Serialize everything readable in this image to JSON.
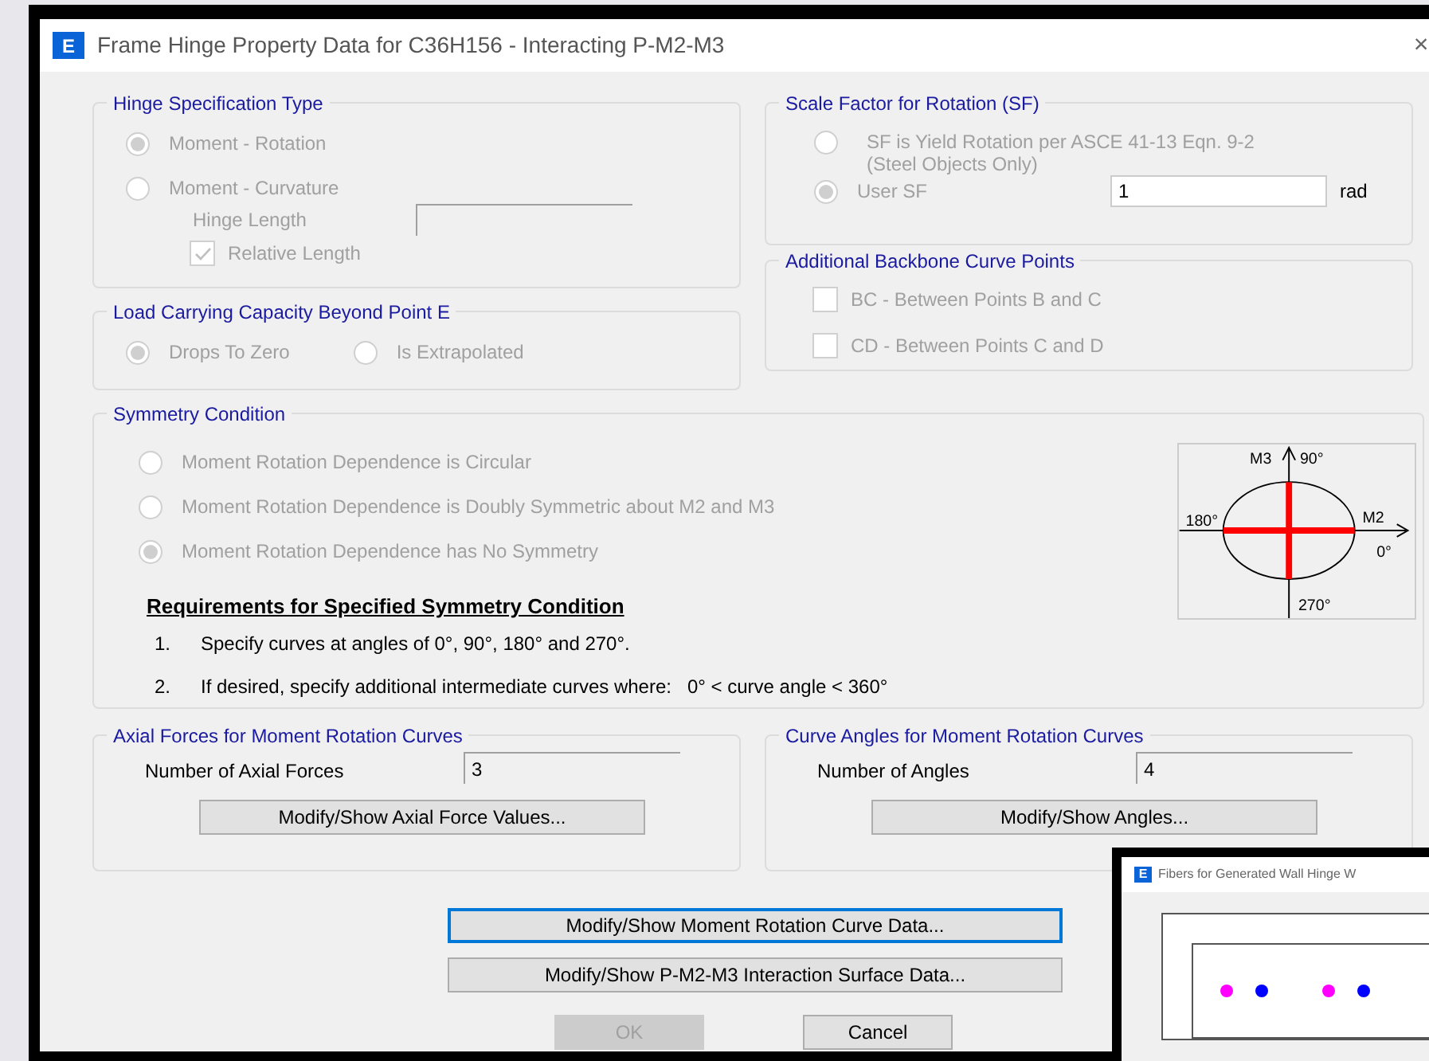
{
  "window": {
    "title": "Frame Hinge Property Data for C36H156 - Interacting P-M2-M3",
    "icon_letter": "E",
    "close": "×"
  },
  "hinge_specification": {
    "title": "Hinge Specification Type",
    "options": [
      {
        "label": "Moment - Rotation",
        "selected": true,
        "disabled": true
      },
      {
        "label": "Moment - Curvature",
        "selected": false,
        "disabled": true
      }
    ],
    "hinge_length": {
      "label": "Hinge Length",
      "disabled": true
    },
    "relative_length": {
      "label": "Relative Length",
      "checked": true,
      "disabled": true
    }
  },
  "load_capacity": {
    "title": "Load Carrying Capacity Beyond Point E",
    "options": [
      {
        "label": "Drops To Zero",
        "selected": true,
        "disabled": true
      },
      {
        "label": "Is Extrapolated",
        "selected": false,
        "disabled": true
      }
    ]
  },
  "scale_factor": {
    "title": "Scale Factor for Rotation (SF)",
    "options": [
      {
        "label": "SF is Yield Rotation per ASCE 41-13 Eqn. 9-2",
        "sublabel": "(Steel Objects Only)",
        "selected": false,
        "disabled": true
      },
      {
        "label": "User SF",
        "selected": true,
        "disabled": true
      }
    ],
    "value": "1",
    "unit": "rad"
  },
  "backbone_points": {
    "title": "Additional Backbone Curve Points",
    "options": [
      {
        "label": "BC - Between Points B and C",
        "checked": false,
        "disabled": true
      },
      {
        "label": "CD - Between Points C and D",
        "checked": false,
        "disabled": true
      }
    ]
  },
  "symmetry": {
    "title": "Symmetry Condition",
    "options": [
      {
        "label": "Moment Rotation Dependence is Circular",
        "selected": false,
        "disabled": true
      },
      {
        "label": "Moment Rotation Dependence is Doubly Symmetric about M2 and M3",
        "selected": false,
        "disabled": true
      },
      {
        "label": "Moment Rotation Dependence has No Symmetry",
        "selected": true,
        "disabled": true
      }
    ],
    "requirements_heading": "Requirements for Specified Symmetry Condition",
    "requirements": [
      {
        "number": "1.",
        "text": "Specify curves at angles of 0°, 90°, 180° and 270°."
      },
      {
        "number": "2.",
        "text": "If desired, specify additional intermediate curves where:   0° < curve angle < 360°"
      }
    ],
    "diagram": {
      "m3": "M3",
      "deg90": "90°",
      "deg180": "180°",
      "m2": "M2",
      "deg0": "0°",
      "deg270": "270°"
    }
  },
  "axial_forces": {
    "title": "Axial Forces for Moment Rotation Curves",
    "label": "Number of Axial Forces",
    "value": "3",
    "button": "Modify/Show Axial Force Values..."
  },
  "curve_angles": {
    "title": "Curve Angles for Moment Rotation Curves",
    "label": "Number of Angles",
    "value": "4",
    "button": "Modify/Show Angles..."
  },
  "buttons": [
    {
      "label": "Modify/Show Moment Rotation Curve Data...",
      "focused": true,
      "disabled": false
    },
    {
      "label": "Modify/Show P-M2-M3 Interaction Surface Data...",
      "focused": false,
      "disabled": false
    }
  ],
  "ok_button": {
    "label": "OK",
    "disabled": true
  },
  "cancel_button": {
    "label": "Cancel",
    "disabled": false
  },
  "background_window": {
    "title": "Fibers for Generated Wall Hinge W",
    "icon_letter": "E",
    "dots": [
      {
        "color": "#ff00ff"
      },
      {
        "color": "#0000ff"
      },
      {
        "color": "#ff00ff"
      },
      {
        "color": "#0000ff"
      }
    ]
  }
}
